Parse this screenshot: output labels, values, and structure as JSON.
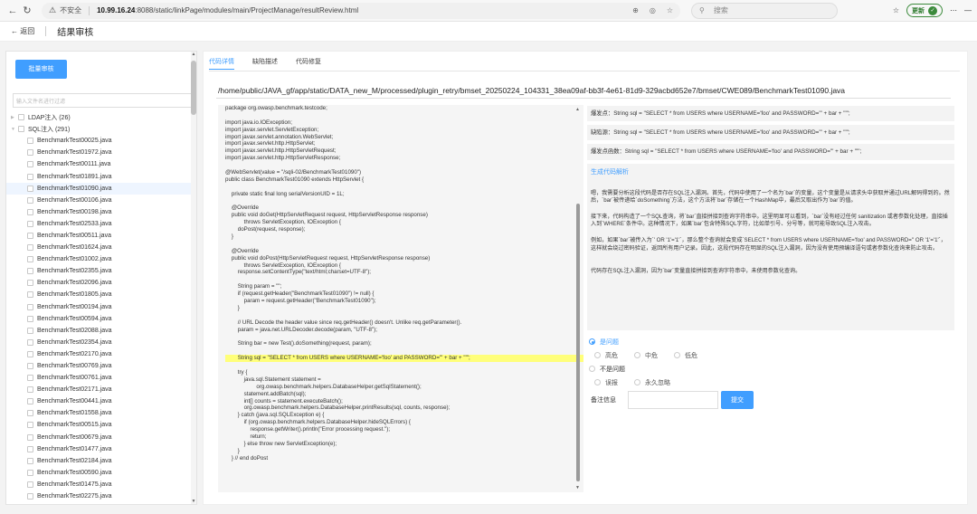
{
  "browser": {
    "insecure_label": "不安全",
    "url_host": "10.99.16.24",
    "url_rest": ":8088/static/linkPage/modules/main/ProjectManage/resultReview.html",
    "search_placeholder": "搜索",
    "update_label": "更新"
  },
  "header": {
    "back_label": "返回",
    "title": "结果审核"
  },
  "sidebar": {
    "batch_button": "批量审核",
    "filter_placeholder": "输入文件名进行过滤",
    "groups": [
      {
        "label": "LDAP注入 (26)"
      },
      {
        "label": "SQL注入 (291)"
      }
    ],
    "files": [
      "BenchmarkTest00025.java",
      "BenchmarkTest01972.java",
      "BenchmarkTest00111.java",
      "BenchmarkTest01891.java",
      "BenchmarkTest01090.java",
      "BenchmarkTest00106.java",
      "BenchmarkTest00198.java",
      "BenchmarkTest02533.java",
      "BenchmarkTest00511.java",
      "BenchmarkTest01624.java",
      "BenchmarkTest01002.java",
      "BenchmarkTest02355.java",
      "BenchmarkTest02096.java",
      "BenchmarkTest01805.java",
      "BenchmarkTest00194.java",
      "BenchmarkTest00594.java",
      "BenchmarkTest02088.java",
      "BenchmarkTest02354.java",
      "BenchmarkTest02170.java",
      "BenchmarkTest00769.java",
      "BenchmarkTest00761.java",
      "BenchmarkTest02171.java",
      "BenchmarkTest00441.java",
      "BenchmarkTest01558.java",
      "BenchmarkTest00515.java",
      "BenchmarkTest00679.java",
      "BenchmarkTest01477.java",
      "BenchmarkTest02184.java",
      "BenchmarkTest00590.java",
      "BenchmarkTest01475.java",
      "BenchmarkTest02275.java"
    ]
  },
  "tabs": [
    "代码详情",
    "缺陷描述",
    "代码修复"
  ],
  "file_path": "/home/public/JAVA_gf/app/static/DATA_new_M/processed/plugin_retry/bmset_20250224_104331_38ea09af-bb3f-4e61-81d9-329acbd652e7/bmset/CWE089/BenchmarkTest01090.java",
  "code_lines": [
    "package org.owasp.benchmark.testcode;",
    "",
    "import java.io.IOException;",
    "import javax.servlet.ServletException;",
    "import javax.servlet.annotation.WebServlet;",
    "import javax.servlet.http.HttpServlet;",
    "import javax.servlet.http.HttpServletRequest;",
    "import javax.servlet.http.HttpServletResponse;",
    "",
    "@WebServlet(value = \"/sqli-02/BenchmarkTest01090\")",
    "public class BenchmarkTest01090 extends HttpServlet {",
    "",
    "    private static final long serialVersionUID = 1L;",
    "",
    "    @Override",
    "    public void doGet(HttpServletRequest request, HttpServletResponse response)",
    "            throws ServletException, IOException {",
    "        doPost(request, response);",
    "    }",
    "",
    "    @Override",
    "    public void doPost(HttpServletRequest request, HttpServletResponse response)",
    "            throws ServletException, IOException {",
    "        response.setContentType(\"text/html;charset=UTF-8\");",
    "",
    "        String param = \"\";",
    "        if (request.getHeader(\"BenchmarkTest01090\") != null) {",
    "            param = request.getHeader(\"BenchmarkTest01090\");",
    "        }",
    "",
    "        // URL Decode the header value since req.getHeader() doesn't. Unlike req.getParameter().",
    "        param = java.net.URLDecoder.decode(param, \"UTF-8\");",
    "",
    "        String bar = new Test().doSomething(request, param);",
    "",
    "        String sql = \"SELECT * from USERS where USERNAME='foo' and PASSWORD='\" + bar + \"'\";",
    "",
    "        try {",
    "            java.sql.Statement statement =",
    "                    org.owasp.benchmark.helpers.DatabaseHelper.getSqlStatement();",
    "            statement.addBatch(sql);",
    "            int[] counts = statement.executeBatch();",
    "            org.owasp.benchmark.helpers.DatabaseHelper.printResults(sql, counts, response);",
    "        } catch (java.sql.SQLException e) {",
    "            if (org.owasp.benchmark.helpers.DatabaseHelper.hideSQLErrors) {",
    "                response.getWriter().println(\"Error processing request.\");",
    "                return;",
    "            } else throw new ServletException(e);",
    "        }",
    "    } // end doPost",
    ""
  ],
  "highlight_line": 35,
  "findings": {
    "trigger": "爆发点：String sql = \"SELECT * from USERS where USERNAME='foo' and PASSWORD='\" + bar + \"'\";",
    "source": "缺陷源：String sql = \"SELECT * from USERS where USERNAME='foo' and PASSWORD='\" + bar + \"'\";",
    "function": "爆发点函数：String sql = \"SELECT * from USERS where USERNAME='foo' and PASSWORD='\" + bar + \"'\";"
  },
  "ai_analysis": {
    "heading": "生成代码解析",
    "p1": "嗯，我需要分析这段代码是否存在SQL注入漏洞。首先，代码中使用了一个名为`bar`的变量，这个变量是从请求头中获取并通过URL解码得到的。然后，`bar`被传递给`doSomething`方法，这个方法将`bar`存储在一个HashMap中，最后又取出作为`bar`的值。",
    "p2": "接下来，代码构造了一个SQL查询，将`bar`直接拼接到查询字符串中。这里明显可以看到，`bar`没有经过任何 sanitization 或者参数化处理，直接插入到`WHERE`条件中。这种情况下，如果`bar`包含特殊SQL字符，比如单引号、分号等，就可能导致SQL注入攻击。",
    "p3": "例如，如果`bar`被传入为`' OR '1'='1'`，那么整个查询就会变成`SELECT * from USERS where USERNAME='foo' and PASSWORD='' OR '1'='1'`，这样就会绕过密码验证，返回所有用户记录。因此，这段代码存在明显的SQL注入漏洞，因为没有使用预编译语句或者参数化查询来防止攻击。",
    "p4": "代码存在SQL注入漏洞，因为`bar`变量直接拼接到查询字符串中，未使用参数化查询。"
  },
  "review": {
    "is_issue": "是问题",
    "severities": [
      "高危",
      "中危",
      "低危"
    ],
    "not_issue": "不是问题",
    "not_issue_opts": [
      "误报",
      "永久忽略"
    ],
    "note_label": "备注信息",
    "submit": "提交"
  }
}
